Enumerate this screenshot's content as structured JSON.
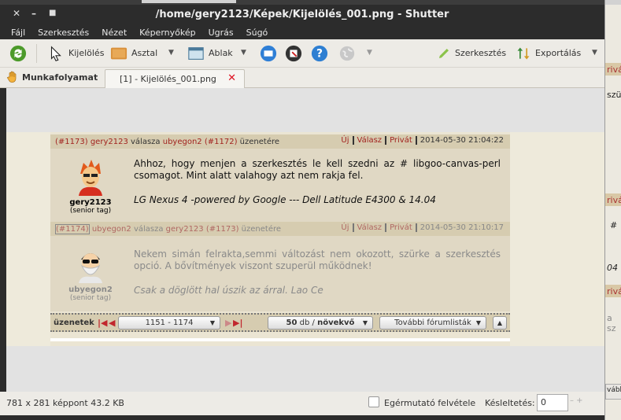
{
  "window": {
    "title": "/home/gery2123/Képek/Kijelölés_001.png - Shutter"
  },
  "menu": [
    "Fájl",
    "Szerkesztés",
    "Nézet",
    "Képernyőkép",
    "Ugrás",
    "Súgó"
  ],
  "toolbar": {
    "selection": "Kijelölés",
    "desktop": "Asztal",
    "window": "Ablak",
    "edit": "Szerkesztés",
    "export": "Exportálás"
  },
  "tabs": {
    "session": "Munkafolyamat",
    "image": "[1] - Kijelölés_001.png"
  },
  "posts": [
    {
      "num": "(#1173)",
      "author": "gery2123",
      "reply_text": "válasza",
      "reply_to": "ubyegon2",
      "reply_num": "(#1172)",
      "suffix": "üzenetére",
      "new": "Új",
      "reply": "Válasz",
      "private": "Privát",
      "date": "2014-05-30 21:04:22",
      "user": "gery2123",
      "rank": "(senior tag)",
      "text": "Ahhoz, hogy menjen a szerkesztés le kell szedni az # libgoo-canvas-perl csomagot. Mint alatt valahogy azt nem rakja fel.",
      "sig": "LG Nexus 4 -powered by Google --- Dell Latitude E4300 & 14.04"
    },
    {
      "num": "(#1174)",
      "author": "ubyegon2",
      "reply_text": "válasza",
      "reply_to": "gery2123",
      "reply_num": "(#1173)",
      "suffix": "üzenetére",
      "new": "Új",
      "reply": "Válasz",
      "private": "Privát",
      "date": "2014-05-30 21:10:17",
      "user": "ubyegon2",
      "rank": "(senior tag)",
      "text": "Nekem simán felrakta,semmi változást nem okozott, szürke a szerkesztés opció. A bővítmények viszont szuperül működnek!",
      "sig": "Csak a döglött hal úszik az árral. Lao Ce"
    }
  ],
  "pager": {
    "label": "üzenetek",
    "range": "1151 - 1174",
    "per_page": "50",
    "per_page_unit": "db /",
    "order": "növekvő",
    "more": "További fórumlisták"
  },
  "status": {
    "info": "781 x 281 képpont  43.2 KB",
    "cursor_label": "Egérmutató felvétele",
    "delay_label": "Késleltetés:",
    "delay_value": "0"
  },
  "behind": {
    "t1": "rivát",
    "t2": "szür",
    "t3": "rivát",
    "t4": "#",
    "t5": "04",
    "t6": "rivát",
    "t7": "a sz",
    "t8": "vább"
  },
  "colors": {
    "accent_red": "#a2231f",
    "forum_header": "#d6ccb0",
    "post_bg": "#e0d8c4"
  }
}
